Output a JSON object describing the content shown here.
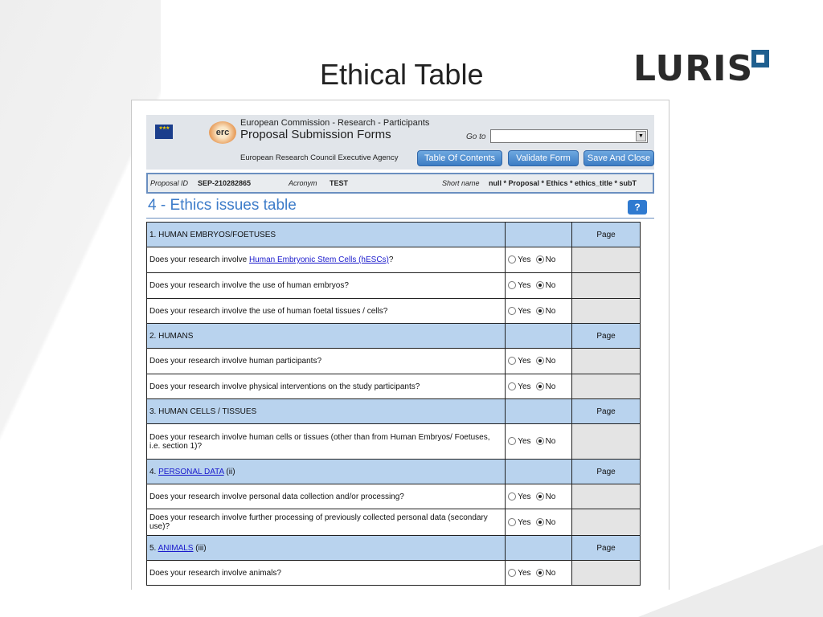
{
  "slide": {
    "title": "Ethical Table",
    "logo": "LURIS"
  },
  "header": {
    "line1": "European Commission - Research - Participants",
    "line2": "Proposal Submission Forms",
    "erc": "erc",
    "goto_label": "Go to",
    "goto_value": "",
    "agency": "European Research Council Executive Agency",
    "buttons": [
      "Table Of Contents",
      "Validate Form",
      "Save And Close"
    ]
  },
  "proposal": {
    "id_label": "Proposal ID",
    "id_value": "SEP-210282865",
    "acronym_label": "Acronym",
    "acronym_value": "TEST",
    "short_label": "Short name",
    "short_value": "null * Proposal * Ethics * ethics_title * subT"
  },
  "section": {
    "title": "4 - Ethics issues table",
    "help": "?"
  },
  "table": {
    "yes": "Yes",
    "no": "No",
    "page": "Page",
    "rows": [
      {
        "type": "cat",
        "text": "1. HUMAN EMBRYOS/FOETUSES"
      },
      {
        "type": "q",
        "pre": "Does your research involve ",
        "link": "Human Embryonic Stem Cells (hESCs)",
        "post": "?",
        "answer": "No"
      },
      {
        "type": "q",
        "pre": "Does your research involve the use of human embryos?",
        "answer": "No"
      },
      {
        "type": "q",
        "pre": "Does your research involve the use of human foetal tissues / cells?",
        "answer": "No"
      },
      {
        "type": "cat",
        "text": "2. HUMANS"
      },
      {
        "type": "q",
        "pre": "Does your research involve human participants?",
        "answer": "No"
      },
      {
        "type": "q",
        "pre": "Does your research involve physical interventions on the study participants?",
        "answer": "No"
      },
      {
        "type": "cat",
        "text": "3. HUMAN CELLS / TISSUES"
      },
      {
        "type": "q",
        "pre": "Does your research involve human cells or tissues (other than from Human Embryos/ Foetuses, i.e. section 1)?",
        "answer": "No",
        "tall": true
      },
      {
        "type": "cat",
        "text": "4. ",
        "link": "PERSONAL DATA",
        "post": " (ii)"
      },
      {
        "type": "q",
        "pre": "Does your research involve personal data collection and/or processing?",
        "answer": "No"
      },
      {
        "type": "q",
        "pre": "Does your research involve further processing of previously collected personal data (secondary use)?",
        "answer": "No"
      },
      {
        "type": "cat",
        "text": "5. ",
        "link": "ANIMALS",
        "post": " (iii)"
      },
      {
        "type": "q",
        "pre": "Does your research involve animals?",
        "answer": "No"
      }
    ]
  }
}
